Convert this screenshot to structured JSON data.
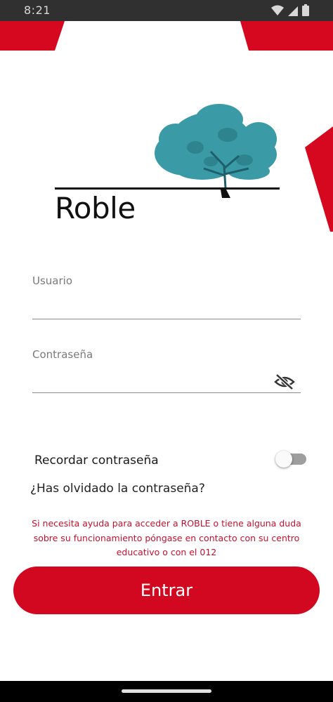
{
  "status_bar": {
    "time": "8:21",
    "icons": [
      "wifi-icon",
      "signal-icon",
      "battery-icon"
    ]
  },
  "app": {
    "logo_text": "Roble",
    "brand_color": "#d1081f",
    "tree_color": "#3a9aa6"
  },
  "form": {
    "username": {
      "label": "Usuario",
      "value": ""
    },
    "password": {
      "label": "Contraseña",
      "value": "",
      "visibility_icon": "eye-off-icon"
    },
    "remember": {
      "label": "Recordar contraseña",
      "checked": false
    },
    "forgot_link": "¿Has olvidado la contraseña?",
    "help_text": "Si necesita ayuda para acceder a ROBLE o tiene alguna duda sobre su funcionamiento póngase en contacto con su centro educativo o con el 012",
    "submit_label": "Entrar"
  }
}
